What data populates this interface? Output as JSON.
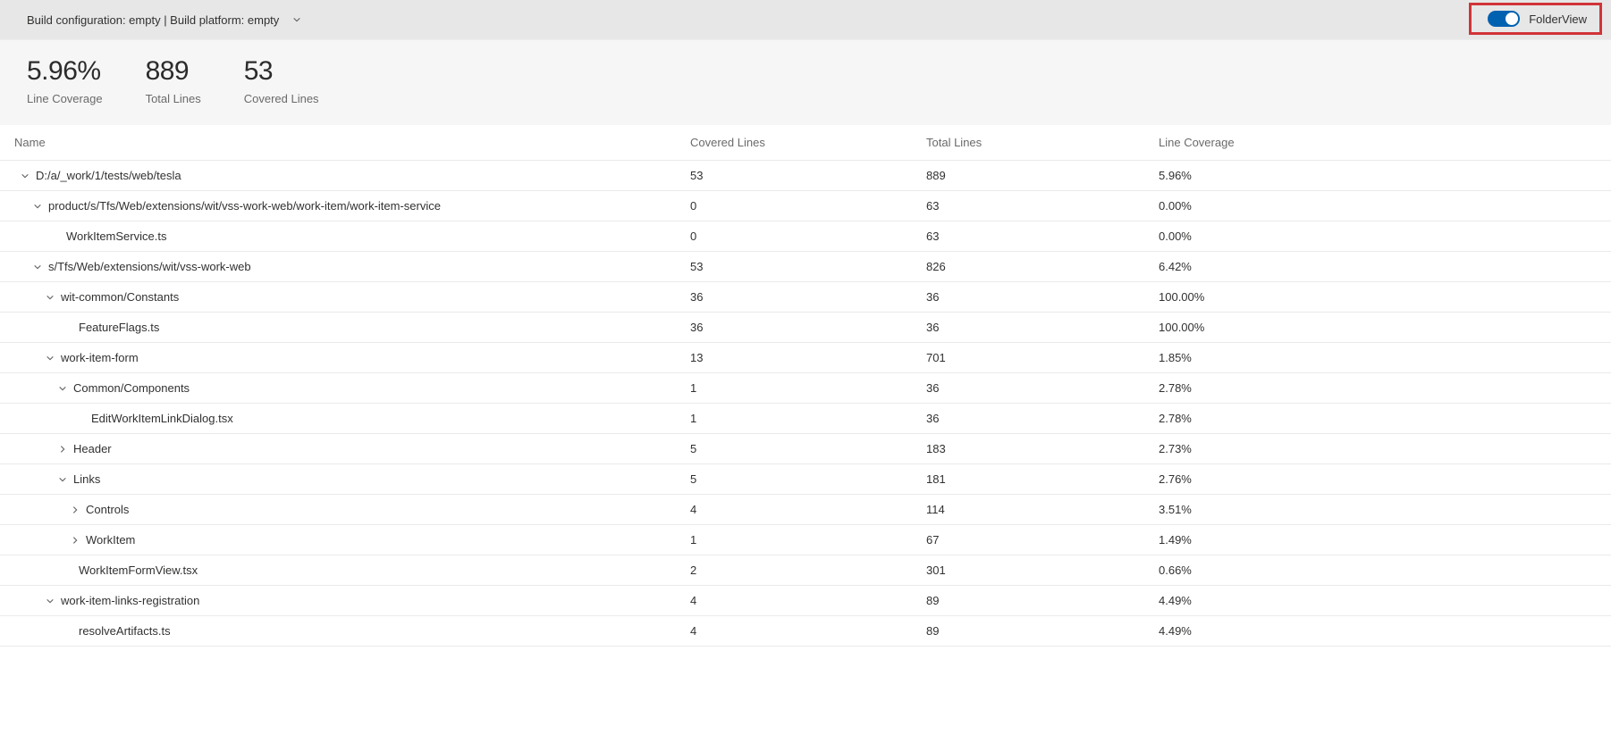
{
  "topbar": {
    "build_config": "Build configuration: empty | Build platform: empty",
    "folder_view_label": "FolderView",
    "folder_view_on": true
  },
  "stats": {
    "line_coverage": {
      "value": "5.96%",
      "label": "Line Coverage"
    },
    "total_lines": {
      "value": "889",
      "label": "Total Lines"
    },
    "covered_lines": {
      "value": "53",
      "label": "Covered Lines"
    }
  },
  "table": {
    "headers": {
      "name": "Name",
      "covered": "Covered Lines",
      "total": "Total Lines",
      "coverage": "Line Coverage"
    },
    "rows": [
      {
        "indent": 0,
        "expand": "down",
        "name": "D:/a/_work/1/tests/web/tesla",
        "covered": "53",
        "total": "889",
        "coverage": "5.96%"
      },
      {
        "indent": 1,
        "expand": "down",
        "name": "product/s/Tfs/Web/extensions/wit/vss-work-web/work-item/work-item-service",
        "covered": "0",
        "total": "63",
        "coverage": "0.00%"
      },
      {
        "indent": 2,
        "expand": "none",
        "name": "WorkItemService.ts",
        "covered": "0",
        "total": "63",
        "coverage": "0.00%"
      },
      {
        "indent": 1,
        "expand": "down",
        "name": "s/Tfs/Web/extensions/wit/vss-work-web",
        "covered": "53",
        "total": "826",
        "coverage": "6.42%"
      },
      {
        "indent": 2,
        "expand": "down",
        "name": "wit-common/Constants",
        "covered": "36",
        "total": "36",
        "coverage": "100.00%"
      },
      {
        "indent": 3,
        "expand": "none",
        "name": "FeatureFlags.ts",
        "covered": "36",
        "total": "36",
        "coverage": "100.00%"
      },
      {
        "indent": 2,
        "expand": "down",
        "name": "work-item-form",
        "covered": "13",
        "total": "701",
        "coverage": "1.85%"
      },
      {
        "indent": 3,
        "expand": "down",
        "name": "Common/Components",
        "covered": "1",
        "total": "36",
        "coverage": "2.78%"
      },
      {
        "indent": 4,
        "expand": "none",
        "name": "EditWorkItemLinkDialog.tsx",
        "covered": "1",
        "total": "36",
        "coverage": "2.78%"
      },
      {
        "indent": 3,
        "expand": "right",
        "name": "Header",
        "covered": "5",
        "total": "183",
        "coverage": "2.73%"
      },
      {
        "indent": 3,
        "expand": "down",
        "name": "Links",
        "covered": "5",
        "total": "181",
        "coverage": "2.76%"
      },
      {
        "indent": 4,
        "expand": "right",
        "name": "Controls",
        "covered": "4",
        "total": "114",
        "coverage": "3.51%"
      },
      {
        "indent": 4,
        "expand": "right",
        "name": "WorkItem",
        "covered": "1",
        "total": "67",
        "coverage": "1.49%"
      },
      {
        "indent": 3,
        "expand": "none",
        "name": "WorkItemFormView.tsx",
        "covered": "2",
        "total": "301",
        "coverage": "0.66%"
      },
      {
        "indent": 2,
        "expand": "down",
        "name": "work-item-links-registration",
        "covered": "4",
        "total": "89",
        "coverage": "4.49%"
      },
      {
        "indent": 3,
        "expand": "none",
        "name": "resolveArtifacts.ts",
        "covered": "4",
        "total": "89",
        "coverage": "4.49%"
      }
    ]
  }
}
